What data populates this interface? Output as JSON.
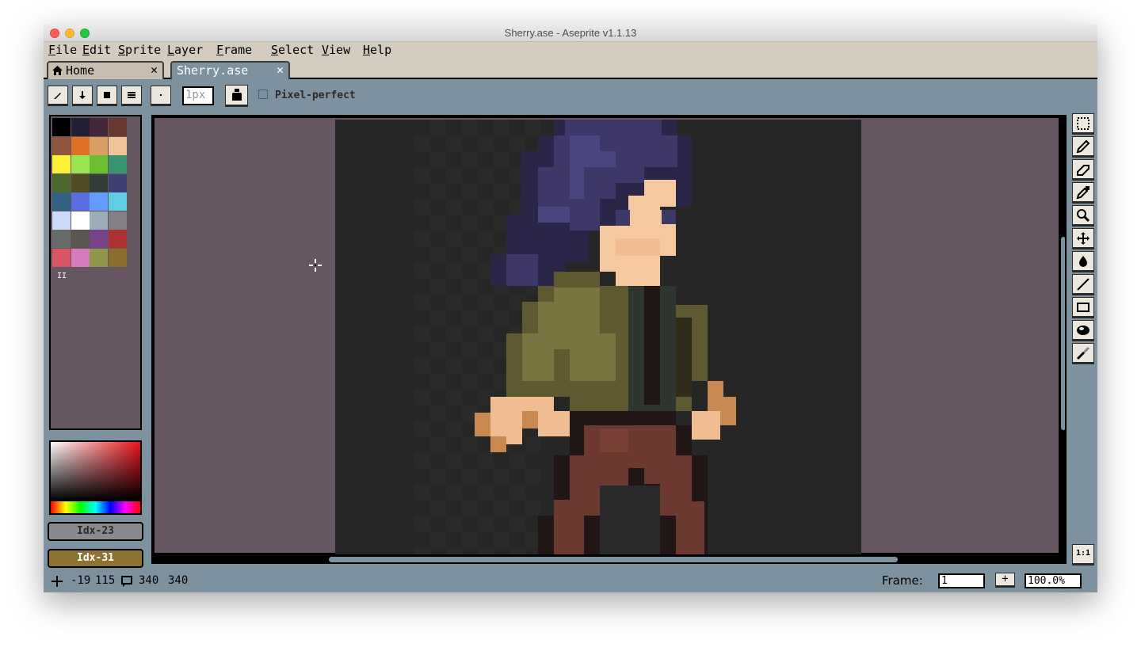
{
  "window": {
    "title": "Sherry.ase - Aseprite v1.1.13"
  },
  "menu": [
    {
      "first": "F",
      "rest": "ile"
    },
    {
      "first": "E",
      "rest": "dit"
    },
    {
      "first": "S",
      "rest": "prite"
    },
    {
      "first": "L",
      "rest": "ayer"
    },
    {
      "first": "F",
      "rest": "rame"
    },
    {
      "first": "S",
      "rest": "elect"
    },
    {
      "first": "V",
      "rest": "iew"
    },
    {
      "first": "H",
      "rest": "elp"
    }
  ],
  "tabs": [
    {
      "label": "Home",
      "close": "✕",
      "icon": "home-icon"
    },
    {
      "label": "Sherry.ase",
      "close": "✕",
      "active": true
    }
  ],
  "toolbar": {
    "brush_size": "1px",
    "pixel_perfect_label": "Pixel-perfect",
    "pixel_perfect_checked": false
  },
  "palette": {
    "colors": [
      "#000000",
      "#222034",
      "#45283c",
      "#663931",
      "#8f563b",
      "#df7126",
      "#d9a066",
      "#eec39a",
      "#fbf236",
      "#99e550",
      "#6abe30",
      "#37946e",
      "#4b692f",
      "#524b24",
      "#323c39",
      "#3f3f74",
      "#306082",
      "#5b6ee1",
      "#639bff",
      "#5fcde4",
      "#cbdbfc",
      "#ffffff",
      "#9badb7",
      "#847e87",
      "#696a6a",
      "#595652",
      "#76428a",
      "#ac3232",
      "#d95763",
      "#d77bba",
      "#8f974a",
      "#8a6f30"
    ]
  },
  "colors": {
    "foreground_label": "Idx-23",
    "foreground_color": "#8a8a8e",
    "background_label": "Idx-31",
    "background_color": "#8d7234"
  },
  "status": {
    "cursor_x": "-19",
    "cursor_y": "115",
    "size_w": "340",
    "size_h": "340",
    "frame_label": "Frame:",
    "frame_value": "1",
    "add_frame": "+",
    "zoom": "100.0%",
    "zoom_reset": "1:1"
  },
  "tools": [
    "rectangular-marquee-icon",
    "pencil-icon",
    "eraser-icon",
    "eyedropper-icon",
    "zoom-icon",
    "move-icon",
    "paint-bucket-icon",
    "line-icon",
    "rectangle-icon",
    "contour-icon",
    "blur-icon"
  ]
}
